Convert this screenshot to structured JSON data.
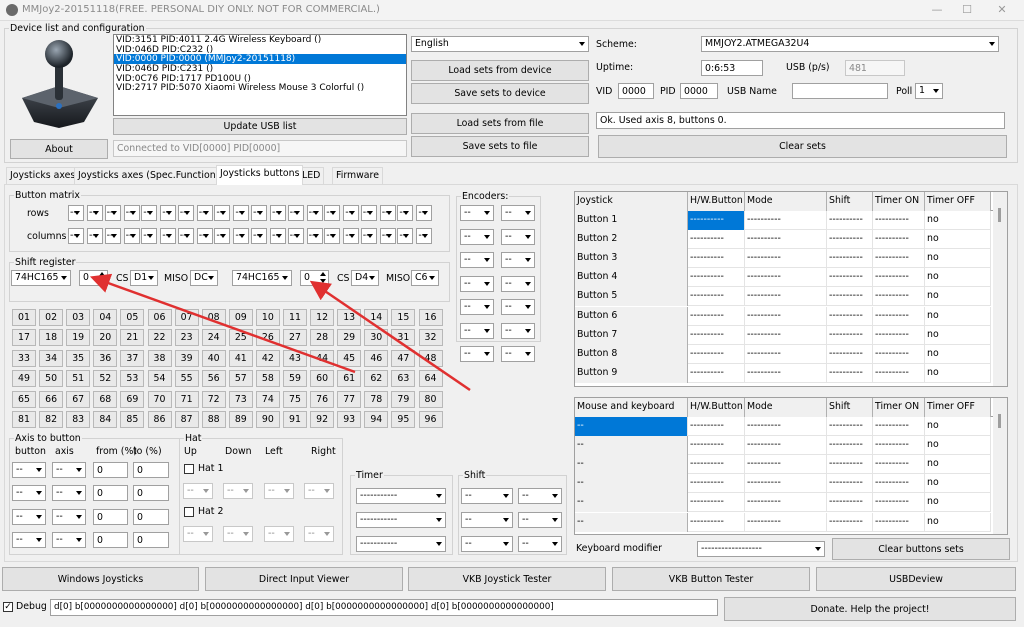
{
  "window": {
    "title": "MMJoy2-20151118(FREE. PERSONAL DIY ONLY. NOT FOR COMMERCIAL.)",
    "min_glyph": "—",
    "max_glyph": "☐",
    "close_glyph": "✕"
  },
  "device_group": {
    "label": "Device list and configuration",
    "devices": [
      "VID:3151 PID:4011 2.4G Wireless Keyboard ()",
      "VID:046D PID:C232 ()",
      "VID:0000 PID:0000  (MMJoy2-20151118)",
      "VID:046D PID:C231 ()",
      "VID:0C76 PID:1717 PD100U ()",
      "VID:2717 PID:5070 Xiaomi Wireless Mouse 3 Colorful ()"
    ],
    "selected_device": 2,
    "about_label": "About",
    "update_usb_label": "Update USB list",
    "connected_status": "Connected to VID[0000] PID[0000]",
    "language": "English",
    "load_from_device_label": "Load sets from device",
    "save_to_device_label": "Save sets to device",
    "load_from_file_label": "Load sets from file",
    "save_to_file_label": "Save sets to file",
    "scheme_label": "Scheme:",
    "scheme_value": "MMJOY2.ATMEGA32U4",
    "uptime_label": "Uptime:",
    "uptime_value": "0:6:53",
    "usb_ps_label": "USB (p/s)",
    "usb_ps_value": "481",
    "vid_label": "VID",
    "vid_value": "0000",
    "pid_label": "PID",
    "pid_value": "0000",
    "usb_name_label": "USB Name",
    "usb_name_value": "",
    "poll_label": "Poll",
    "poll_value": "1",
    "status_message": "Ok. Used axis  8, buttons 0.",
    "clear_sets_label": "Clear sets"
  },
  "tabs": [
    "Joysticks axes",
    "Joysticks axes (Spec.Functions)",
    "Joysticks buttons",
    "LED",
    "Firmware"
  ],
  "active_tab": 2,
  "button_matrix": {
    "label": "Button matrix",
    "rows_label": "rows",
    "columns_label": "columns",
    "placeholder": "--",
    "count": 10
  },
  "shift_register": {
    "label": "Shift register",
    "sets": [
      {
        "chip": "74HC165",
        "count": "0",
        "cs_label": "CS",
        "cs": "D1",
        "miso_label": "MISO",
        "miso": "DC"
      },
      {
        "chip": "74HC165",
        "count": "0",
        "cs_label": "CS",
        "cs": "D4",
        "miso_label": "MISO",
        "miso": "C6"
      }
    ]
  },
  "button_numbers": [
    "01",
    "02",
    "03",
    "04",
    "05",
    "06",
    "07",
    "08",
    "09",
    "10",
    "11",
    "12",
    "13",
    "14",
    "15",
    "16",
    "17",
    "18",
    "19",
    "20",
    "21",
    "22",
    "23",
    "24",
    "25",
    "26",
    "27",
    "28",
    "29",
    "30",
    "31",
    "32",
    "33",
    "34",
    "35",
    "36",
    "37",
    "38",
    "39",
    "40",
    "41",
    "42",
    "43",
    "44",
    "45",
    "46",
    "47",
    "48",
    "49",
    "50",
    "51",
    "52",
    "53",
    "54",
    "55",
    "56",
    "57",
    "58",
    "59",
    "60",
    "61",
    "62",
    "63",
    "64",
    "65",
    "66",
    "67",
    "68",
    "69",
    "70",
    "71",
    "72",
    "73",
    "74",
    "75",
    "76",
    "77",
    "78",
    "79",
    "80",
    "81",
    "82",
    "83",
    "84",
    "85",
    "86",
    "87",
    "88",
    "89",
    "90",
    "91",
    "92",
    "93",
    "94",
    "95",
    "96"
  ],
  "encoders": {
    "label": "Encoders:",
    "rows": 7,
    "placeholder": "--"
  },
  "axis_to_button": {
    "label": "Axis to button",
    "col_button": "button",
    "col_axis": "axis",
    "col_from": "from (%)",
    "col_to": "to (%)",
    "rows": [
      {
        "button": "--",
        "axis": "--",
        "from": "0",
        "to": "0"
      },
      {
        "button": "--",
        "axis": "--",
        "from": "0",
        "to": "0"
      },
      {
        "button": "--",
        "axis": "--",
        "from": "0",
        "to": "0"
      },
      {
        "button": "--",
        "axis": "--",
        "from": "0",
        "to": "0"
      }
    ]
  },
  "hat": {
    "label": "Hat",
    "up": "Up",
    "down": "Down",
    "left": "Left",
    "right": "Right",
    "hat1": "Hat 1",
    "hat2": "Hat 2",
    "placeholder": "--"
  },
  "timer": {
    "label": "Timer",
    "placeholder": "-----------"
  },
  "shift": {
    "label": "Shift",
    "placeholder": "--"
  },
  "joystick_grid": {
    "headers": [
      "Joystick",
      "H/W.Button",
      "Mode",
      "Shift",
      "Timer ON",
      "Timer OFF"
    ],
    "rows": [
      [
        "Button 1",
        "----------",
        "----------",
        "----------",
        "----------",
        "no"
      ],
      [
        "Button 2",
        "----------",
        "----------",
        "----------",
        "----------",
        "no"
      ],
      [
        "Button 3",
        "----------",
        "----------",
        "----------",
        "----------",
        "no"
      ],
      [
        "Button 4",
        "----------",
        "----------",
        "----------",
        "----------",
        "no"
      ],
      [
        "Button 5",
        "----------",
        "----------",
        "----------",
        "----------",
        "no"
      ],
      [
        "Button 6",
        "----------",
        "----------",
        "----------",
        "----------",
        "no"
      ],
      [
        "Button 7",
        "----------",
        "----------",
        "----------",
        "----------",
        "no"
      ],
      [
        "Button 8",
        "----------",
        "----------",
        "----------",
        "----------",
        "no"
      ],
      [
        "Button 9",
        "----------",
        "----------",
        "----------",
        "----------",
        "no"
      ]
    ]
  },
  "mk_grid": {
    "headers": [
      "Mouse and keyboard",
      "H/W.Button",
      "Mode",
      "Shift",
      "Timer ON",
      "Timer OFF"
    ],
    "rows": [
      [
        "--",
        "----------",
        "----------",
        "----------",
        "----------",
        "no"
      ],
      [
        "--",
        "----------",
        "----------",
        "----------",
        "----------",
        "no"
      ],
      [
        "--",
        "----------",
        "----------",
        "----------",
        "----------",
        "no"
      ],
      [
        "--",
        "----------",
        "----------",
        "----------",
        "----------",
        "no"
      ],
      [
        "--",
        "----------",
        "----------",
        "----------",
        "----------",
        "no"
      ],
      [
        "--",
        "----------",
        "----------",
        "----------",
        "----------",
        "no"
      ]
    ]
  },
  "keyboard_modifier": {
    "label": "Keyboard modifier",
    "value": "------------------",
    "clear_label": "Clear buttons sets"
  },
  "bottom_buttons": [
    "Windows Joysticks",
    "Direct Input Viewer",
    "VKB Joystick Tester",
    "VKB Button Tester",
    "USBDeview"
  ],
  "debug": {
    "label": "Debug",
    "checked": true,
    "output": "d[0] b[0000000000000000]   d[0] b[0000000000000000]   d[0] b[0000000000000000]   d[0] b[0000000000000000]"
  },
  "donate_label": "Donate. Help the project!",
  "colors": {
    "selection": "#0078d7",
    "annotation_arrow": "#e03030"
  }
}
